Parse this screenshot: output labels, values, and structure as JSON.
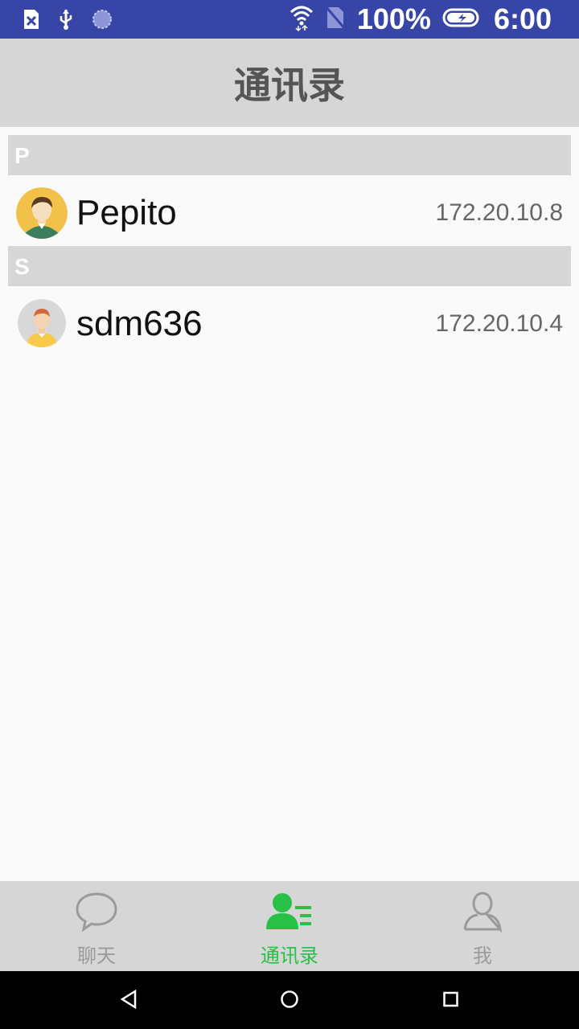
{
  "status_bar": {
    "battery_percent": "100%",
    "time": "6:00",
    "icons": [
      "sim-error-icon",
      "usb-icon",
      "sync-icon",
      "wifi-icon",
      "no-sim-icon",
      "battery-icon"
    ]
  },
  "header": {
    "title": "通讯录"
  },
  "contacts": [
    {
      "section": "P",
      "name": "Pepito",
      "ip": "172.20.10.8",
      "avatar": "avatar-man-icon"
    },
    {
      "section": "S",
      "name": "sdm636",
      "ip": "172.20.10.4",
      "avatar": "avatar-boy-icon"
    }
  ],
  "tabs": [
    {
      "label": "聊天",
      "icon": "chat-bubble-icon",
      "active": false
    },
    {
      "label": "通讯录",
      "icon": "contacts-icon",
      "active": true
    },
    {
      "label": "我",
      "icon": "profile-icon",
      "active": false
    }
  ],
  "colors": {
    "status_bar": "#3746a6",
    "header_bg": "#d6d6d6",
    "active_tab": "#28c046",
    "inactive_tab": "#9a9a9a"
  }
}
